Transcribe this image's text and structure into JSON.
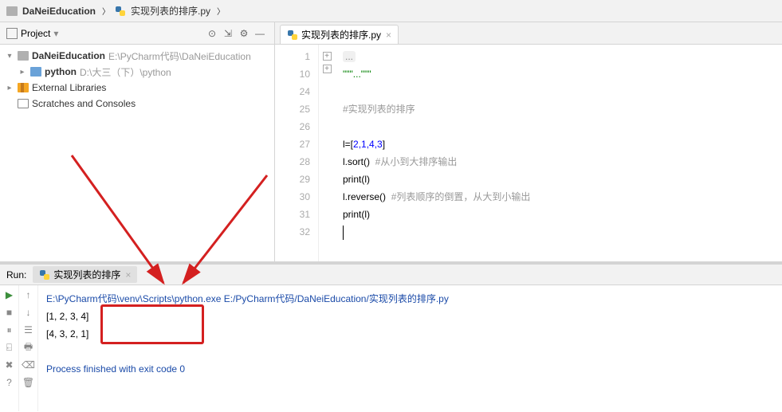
{
  "breadcrumb": {
    "proj": "DaNeiEducation",
    "file": "实现列表的排序.py"
  },
  "projectPane": {
    "title": "Project"
  },
  "tree": {
    "root": "DaNeiEducation",
    "rootHint": "E:\\PyCharm代码\\DaNeiEducation",
    "python": "python",
    "pythonHint": "D:\\大三（下）\\python",
    "ext": "External Libraries",
    "scratch": "Scratches and Consoles"
  },
  "tab": {
    "name": "实现列表的排序.py"
  },
  "gutter": [
    "1",
    "10",
    "24",
    "25",
    "26",
    "27",
    "28",
    "29",
    "30",
    "31",
    "32"
  ],
  "code": {
    "dots": "...",
    "docstr": "\"\"\"...\"\"\"",
    "cmt1": "#实现列表的排序",
    "l_eq": "l=[",
    "vals": "2,1,4,3",
    "rb": "]",
    "sort": "l.sort()  ",
    "sort_cmt": "#从小到大排序输出",
    "print1": "print(l)",
    "rev": "l.reverse()  ",
    "rev_cmt": "#列表顺序的倒置，从大到小输出",
    "print2": "print(l)"
  },
  "run": {
    "label": "Run:",
    "tab": "实现列表的排序",
    "path": "E:\\PyCharm代码\\venv\\Scripts\\python.exe E:/PyCharm代码/DaNeiEducation/实现列表的排序.py",
    "out1": "[1, 2, 3, 4]",
    "out2": "[4, 3, 2, 1]",
    "exit": "Process finished with exit code 0"
  }
}
